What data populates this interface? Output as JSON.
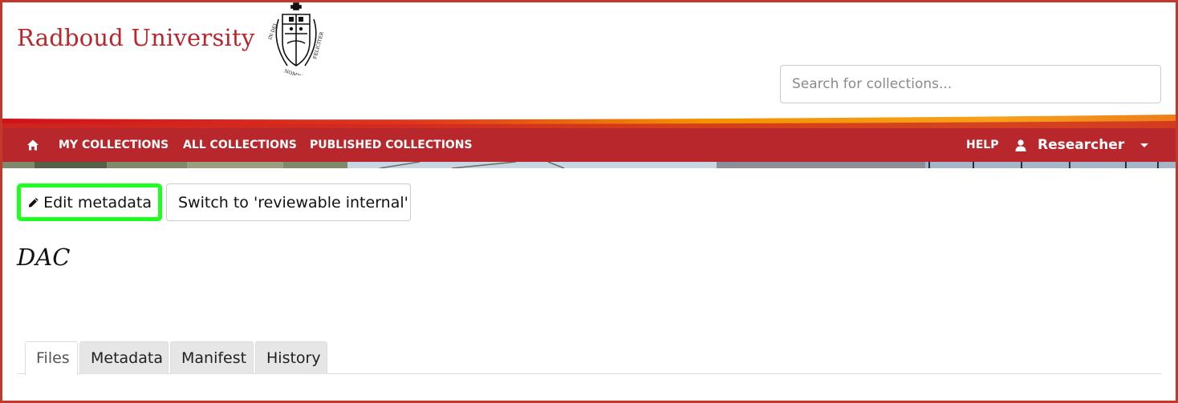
{
  "header": {
    "brand": "Radboud University",
    "search": {
      "placeholder": "Search for collections...",
      "value": ""
    }
  },
  "nav": {
    "home_icon": "home-icon",
    "items": [
      {
        "label": "MY COLLECTIONS"
      },
      {
        "label": "ALL COLLECTIONS"
      },
      {
        "label": "PUBLISHED COLLECTIONS"
      }
    ],
    "help": "HELP",
    "user_icon": "user-icon",
    "user": "Researcher",
    "user_menu_icon": "caret-down-icon"
  },
  "actions": {
    "edit_icon": "pencil-icon",
    "edit_label": "Edit metadata",
    "switch_label": "Switch to 'reviewable internal'"
  },
  "collection": {
    "title": "DAC"
  },
  "tabs": [
    {
      "label": "Files",
      "active": true
    },
    {
      "label": "Metadata",
      "active": false
    },
    {
      "label": "Manifest",
      "active": false
    },
    {
      "label": "History",
      "active": false
    }
  ],
  "colors": {
    "brand_red": "#b8272b",
    "swoosh_orange": "#f39200",
    "edit_highlight": "#1fff1f"
  }
}
